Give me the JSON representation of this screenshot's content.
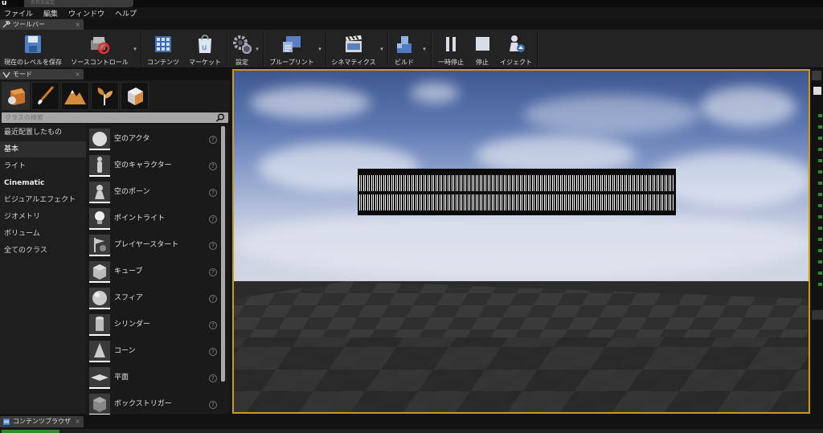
{
  "window": {
    "title": "名称未設定"
  },
  "menu": [
    "ファイル",
    "編集",
    "ウィンドウ",
    "ヘルプ"
  ],
  "toolbar_tab": "ツールバー",
  "toolbar": [
    {
      "label": "現在のレベルを保存",
      "icon": "save-icon"
    },
    {
      "label": "ソースコントロール",
      "icon": "source-control-icon"
    },
    {
      "label": "コンテンツ",
      "icon": "content-icon"
    },
    {
      "label": "マーケット",
      "icon": "marketplace-icon"
    },
    {
      "label": "設定",
      "icon": "settings-icon"
    },
    {
      "label": "ブループリント",
      "icon": "blueprint-icon"
    },
    {
      "label": "シネマティクス",
      "icon": "cinematics-icon"
    },
    {
      "label": "ビルド",
      "icon": "build-icon"
    },
    {
      "label": "一時停止",
      "icon": "pause-icon"
    },
    {
      "label": "停止",
      "icon": "stop-icon"
    },
    {
      "label": "イジェクト",
      "icon": "eject-icon"
    }
  ],
  "modes_tab": "モード",
  "search": {
    "placeholder": "クラスの検索"
  },
  "categories": [
    {
      "label": "最近配置したもの"
    },
    {
      "label": "基本",
      "selected": true
    },
    {
      "label": "ライト"
    },
    {
      "label": "Cinematic"
    },
    {
      "label": "ビジュアルエフェクト"
    },
    {
      "label": "ジオメトリ"
    },
    {
      "label": "ボリューム"
    },
    {
      "label": "全てのクラス"
    }
  ],
  "place_items": [
    {
      "label": "空のアクタ",
      "icon": "sphere-icon"
    },
    {
      "label": "空のキャラクター",
      "icon": "character-icon"
    },
    {
      "label": "空のポーン",
      "icon": "pawn-icon"
    },
    {
      "label": "ポイントライト",
      "icon": "light-bulb-icon"
    },
    {
      "label": "プレイヤースタート",
      "icon": "player-start-icon"
    },
    {
      "label": "キューブ",
      "icon": "cube-icon"
    },
    {
      "label": "スフィア",
      "icon": "sphere-icon"
    },
    {
      "label": "シリンダー",
      "icon": "cylinder-icon"
    },
    {
      "label": "コーン",
      "icon": "cone-icon"
    },
    {
      "label": "平面",
      "icon": "plane-icon"
    },
    {
      "label": "ボックストリガー",
      "icon": "box-trigger-icon"
    }
  ],
  "help_glyph": "?",
  "bottom_tab": "コンテンツブラウザ",
  "colors": {
    "viewport_border": "#c79a22",
    "accent": "#2e8b2e"
  }
}
